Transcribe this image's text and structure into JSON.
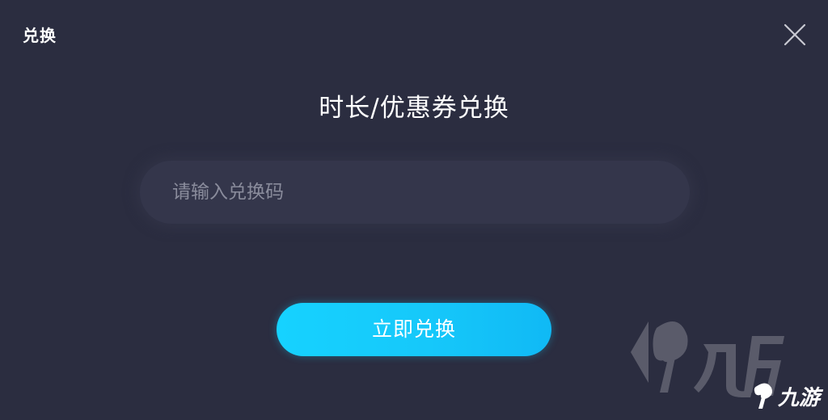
{
  "window": {
    "title": "兑换"
  },
  "dialog": {
    "heading": "时长/优惠券兑换"
  },
  "code_input": {
    "placeholder": "请输入兑换码",
    "value": ""
  },
  "redeem_button": {
    "label": "立即兑换"
  },
  "watermark": {
    "brand_text": "九游"
  },
  "colors": {
    "background": "#2b2d40",
    "input_background": "#34364b",
    "placeholder": "#8a8c9c",
    "button_gradient_start": "#16d2ff",
    "button_gradient_end": "#10b9f5",
    "text": "#ffffff"
  },
  "icons": {
    "close": "close-icon",
    "watermark_logo": "nine-game-logo-icon"
  }
}
